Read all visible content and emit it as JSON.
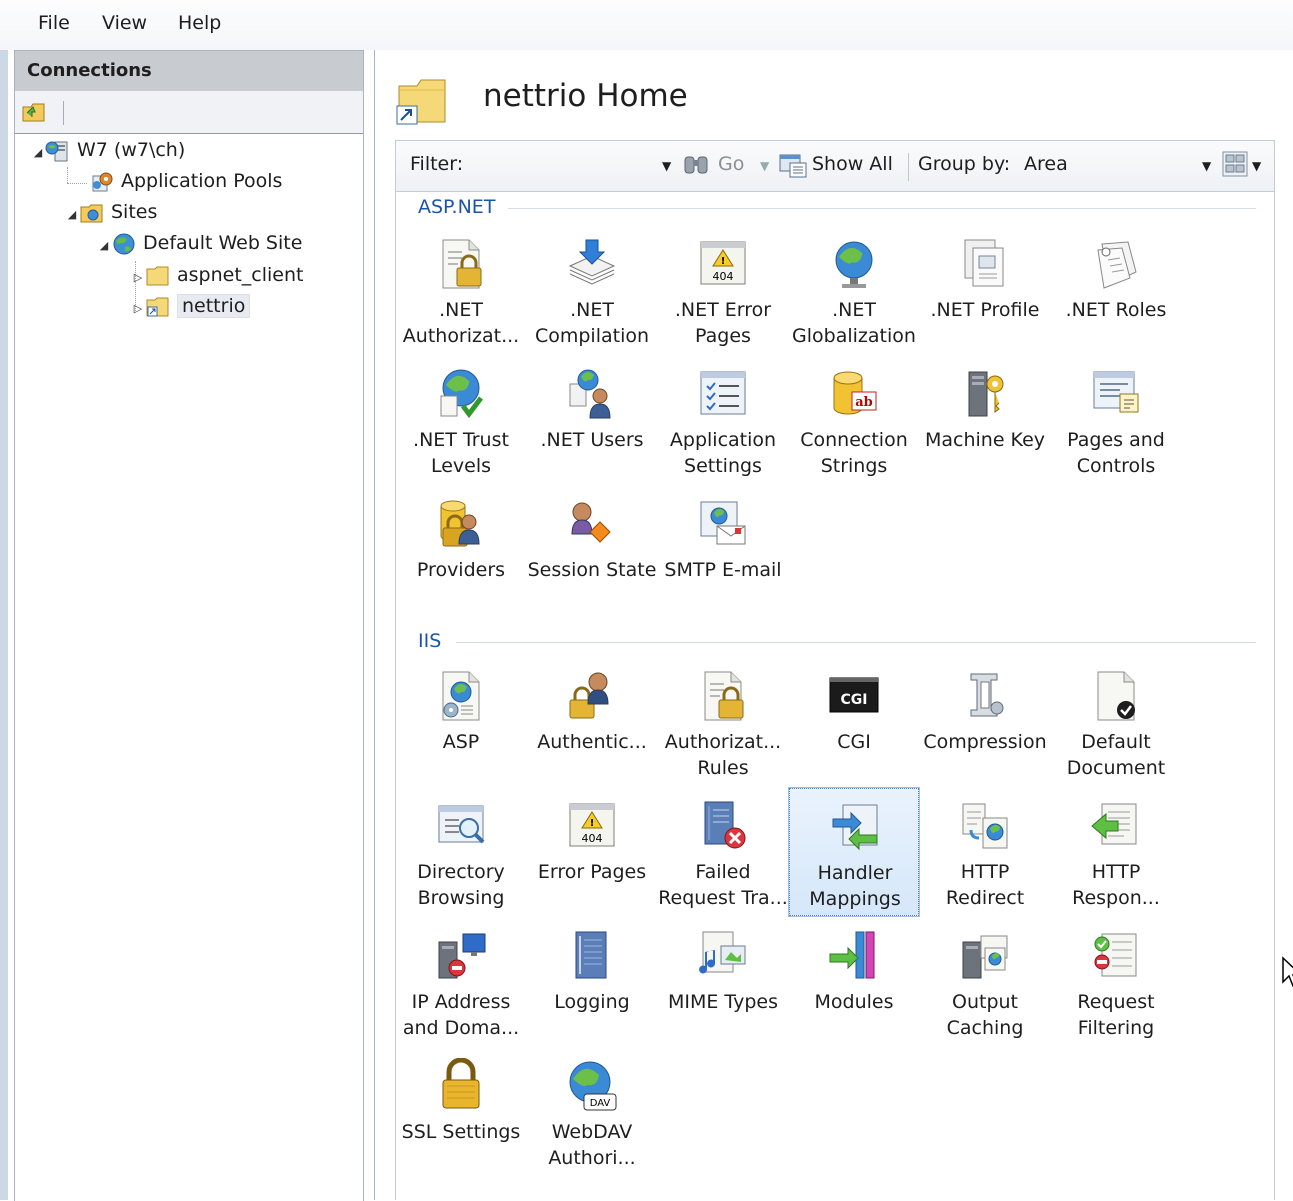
{
  "menu": {
    "file": "File",
    "view": "View",
    "help": "Help"
  },
  "connections": {
    "header": "Connections",
    "tree": {
      "server": "W7 (w7\\ch)",
      "app_pools": "Application Pools",
      "sites": "Sites",
      "default_site": "Default Web Site",
      "aspnet_client": "aspnet_client",
      "nettrio": "nettrio"
    }
  },
  "main": {
    "title": "nettrio Home",
    "filter": {
      "label": "Filter:",
      "value": "",
      "go": "Go",
      "show_all": "Show All",
      "group_by_label": "Group by:",
      "group_by_value": "Area"
    },
    "sections": {
      "aspnet": {
        "title": "ASP.NET",
        "items": [
          {
            "label": ".NET\nAuthorizat...",
            "icon": "authorization-lock-icon"
          },
          {
            "label": ".NET\nCompilation",
            "icon": "compilation-stack-icon"
          },
          {
            "label": ".NET Error\nPages",
            "icon": "error-404-icon"
          },
          {
            "label": ".NET\nGlobalization",
            "icon": "globe-icon"
          },
          {
            "label": ".NET Profile",
            "icon": "profile-icon"
          },
          {
            "label": ".NET Roles",
            "icon": "roles-icon"
          },
          {
            "label": ".NET Trust\nLevels",
            "icon": "trust-globe-check-icon"
          },
          {
            "label": ".NET Users",
            "icon": "users-icon"
          },
          {
            "label": "Application\nSettings",
            "icon": "settings-list-icon"
          },
          {
            "label": "Connection\nStrings",
            "icon": "database-ab-icon"
          },
          {
            "label": "Machine Key",
            "icon": "server-key-icon"
          },
          {
            "label": "Pages and\nControls",
            "icon": "pages-controls-icon"
          },
          {
            "label": "Providers",
            "icon": "providers-icon"
          },
          {
            "label": "Session State",
            "icon": "session-user-icon"
          },
          {
            "label": "SMTP E-mail",
            "icon": "smtp-email-icon"
          }
        ]
      },
      "iis": {
        "title": "IIS",
        "items": [
          {
            "label": "ASP",
            "icon": "asp-globe-gear-icon"
          },
          {
            "label": "Authentic...",
            "icon": "authentication-user-icon"
          },
          {
            "label": "Authorizat...\nRules",
            "icon": "authorization-rules-icon"
          },
          {
            "label": "CGI",
            "icon": "cgi-icon"
          },
          {
            "label": "Compression",
            "icon": "compression-clamp-icon"
          },
          {
            "label": "Default\nDocument",
            "icon": "default-document-icon"
          },
          {
            "label": "Directory\nBrowsing",
            "icon": "directory-browsing-icon"
          },
          {
            "label": "Error Pages",
            "icon": "error-pages-icon"
          },
          {
            "label": "Failed\nRequest Tra...",
            "icon": "failed-request-icon"
          },
          {
            "label": "Handler\nMappings",
            "icon": "handler-mappings-icon"
          },
          {
            "label": "HTTP\nRedirect",
            "icon": "http-redirect-icon"
          },
          {
            "label": "HTTP\nRespon...",
            "icon": "http-response-icon"
          },
          {
            "label": "IP Address\nand Doma...",
            "icon": "ip-address-icon"
          },
          {
            "label": "Logging",
            "icon": "logging-notebook-icon"
          },
          {
            "label": "MIME Types",
            "icon": "mime-types-icon"
          },
          {
            "label": "Modules",
            "icon": "modules-icon"
          },
          {
            "label": "Output\nCaching",
            "icon": "output-caching-icon"
          },
          {
            "label": "Request\nFiltering",
            "icon": "request-filtering-icon"
          },
          {
            "label": "SSL Settings",
            "icon": "ssl-lock-icon"
          },
          {
            "label": "WebDAV\nAuthori...",
            "icon": "webdav-globe-icon"
          }
        ]
      }
    }
  }
}
